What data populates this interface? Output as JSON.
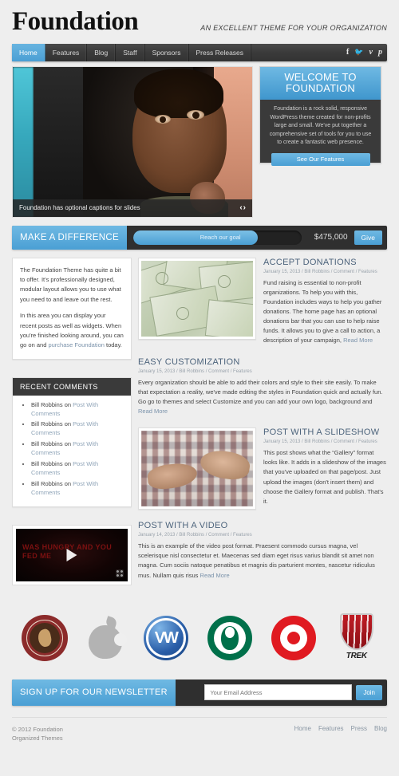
{
  "header": {
    "site_title": "Foundation",
    "tagline": "AN EXCELLENT THEME FOR YOUR ORGANIZATION"
  },
  "nav": {
    "items": [
      {
        "label": "Home",
        "active": true
      },
      {
        "label": "Features",
        "active": false
      },
      {
        "label": "Blog",
        "active": false
      },
      {
        "label": "Staff",
        "active": false
      },
      {
        "label": "Sponsors",
        "active": false
      },
      {
        "label": "Press Releases",
        "active": false
      }
    ],
    "social": [
      {
        "name": "facebook-icon",
        "glyph": "f"
      },
      {
        "name": "twitter-icon",
        "glyph": "ᴠ"
      },
      {
        "name": "vimeo-icon",
        "glyph": "v"
      },
      {
        "name": "pinterest-icon",
        "glyph": "ᴘ"
      }
    ]
  },
  "slider": {
    "caption": "Foundation has optional captions for slides",
    "prev_glyph": "‹",
    "next_glyph": "›"
  },
  "welcome": {
    "title_line1": "WELCOME TO",
    "title_line2": "FOUNDATION",
    "body": "Foundation is a rock solid, responsive WordPress theme created for non-profits large and small. We've put together a comprehensive set of tools for you to use to create a fantastic web presence.",
    "button": "See Our Features"
  },
  "donation_bar": {
    "title": "MAKE A DIFFERENCE",
    "progress_label": "Reach our goal",
    "progress_percent": 74,
    "amount": "$475,000",
    "button": "Give"
  },
  "intro": {
    "paragraph1": "The Foundation Theme has quite a bit to offer. It's professionally designed, modular layout allows you to use what you need to and leave out the rest.",
    "paragraph2_before": "In this area you can display your recent posts as well as widgets. When you're finished looking around, you can go on and ",
    "paragraph2_link": "purchase Foundation",
    "paragraph2_after": " today."
  },
  "recent_comments": {
    "title": "RECENT COMMENTS",
    "items": [
      {
        "author": "Bill Robbins",
        "on": " on ",
        "post": "Post With Comments"
      },
      {
        "author": "Bill Robbins",
        "on": " on ",
        "post": "Post With Comments"
      },
      {
        "author": "Bill Robbins",
        "on": " on ",
        "post": "Post With Comments"
      },
      {
        "author": "Bill Robbins",
        "on": " on ",
        "post": "Post With Comments"
      },
      {
        "author": "Bill Robbins",
        "on": " on ",
        "post": "Post With Comments"
      }
    ]
  },
  "video_widget": {
    "overlay_text": "WAS HUNGRY AND YOU FED ME"
  },
  "posts": [
    {
      "title": "ACCEPT DONATIONS",
      "meta": "January 15, 2013 / Bill Robbins / Comment / Features",
      "body": "Fund raising is essential to non-profit organizations. To help you with this, Foundation includes ways to help you gather donations. The home page has an optional donations bar that you can use to help raise funds. It allows you to give a call to action, a description of your campaign,",
      "read_more": "Read More",
      "thumb": "money-image"
    },
    {
      "title": "EASY CUSTOMIZATION",
      "meta": "January 15, 2013 / Bill Robbins / Comment / Features",
      "body": "Every organization should be able to add their colors and style to their site easily. To make that expectation a reality, we've made editing the styles in Foundation quick and actually fun. Go go to themes and select Customize and you can add your own logo, background and",
      "read_more": "Read More",
      "thumb": null
    },
    {
      "title": "POST WITH A SLIDESHOW",
      "meta": "January 15, 2013 / Bill Robbins / Comment / Features",
      "body": "This post shows what the “Gallery” format looks like. It adds in a slideshow of the images that you've uploaded on that page/post. Just upload the images (don't insert them) and choose the Gallery format and publish. That's it.",
      "read_more": "",
      "thumb": "hands-image"
    },
    {
      "title": "POST WITH A VIDEO",
      "meta": "January 14, 2013 / Bill Robbins / Comment / Features",
      "body": "This is an example of the video post format. Praesent commodo cursus magna, vel scelerisque nisl consectetur et. Maecenas sed diam eget risus varius blandit sit amet non magna. Cum sociis natoque penatibus et magnis dis parturient montes, nascetur ridiculus mus. Nullam quis risus",
      "read_more": "Read More",
      "thumb": null
    }
  ],
  "sponsors": [
    {
      "name": "chipotle-logo",
      "label": "CHIPOTLE MEXICAN GRILL"
    },
    {
      "name": "apple-logo",
      "label": "Apple"
    },
    {
      "name": "volkswagen-logo",
      "label": "VW"
    },
    {
      "name": "starbucks-logo",
      "label": "Starbucks"
    },
    {
      "name": "target-logo",
      "label": "Target"
    },
    {
      "name": "trek-logo",
      "label": "TREK"
    }
  ],
  "newsletter": {
    "title": "SIGN UP FOR OUR NEWSLETTER",
    "placeholder": "Your Email Address",
    "value": "",
    "button": "Join"
  },
  "footer": {
    "copyright": "© 2012 Foundation",
    "credit": "Organized Themes",
    "links": [
      {
        "label": "Home"
      },
      {
        "label": "Features"
      },
      {
        "label": "Press"
      },
      {
        "label": "Blog"
      }
    ]
  },
  "colors": {
    "accent_blue": "#4a9fd4",
    "dark_bar": "#333333",
    "page_bg": "#eeeeee",
    "title_blue": "#4d647c"
  }
}
